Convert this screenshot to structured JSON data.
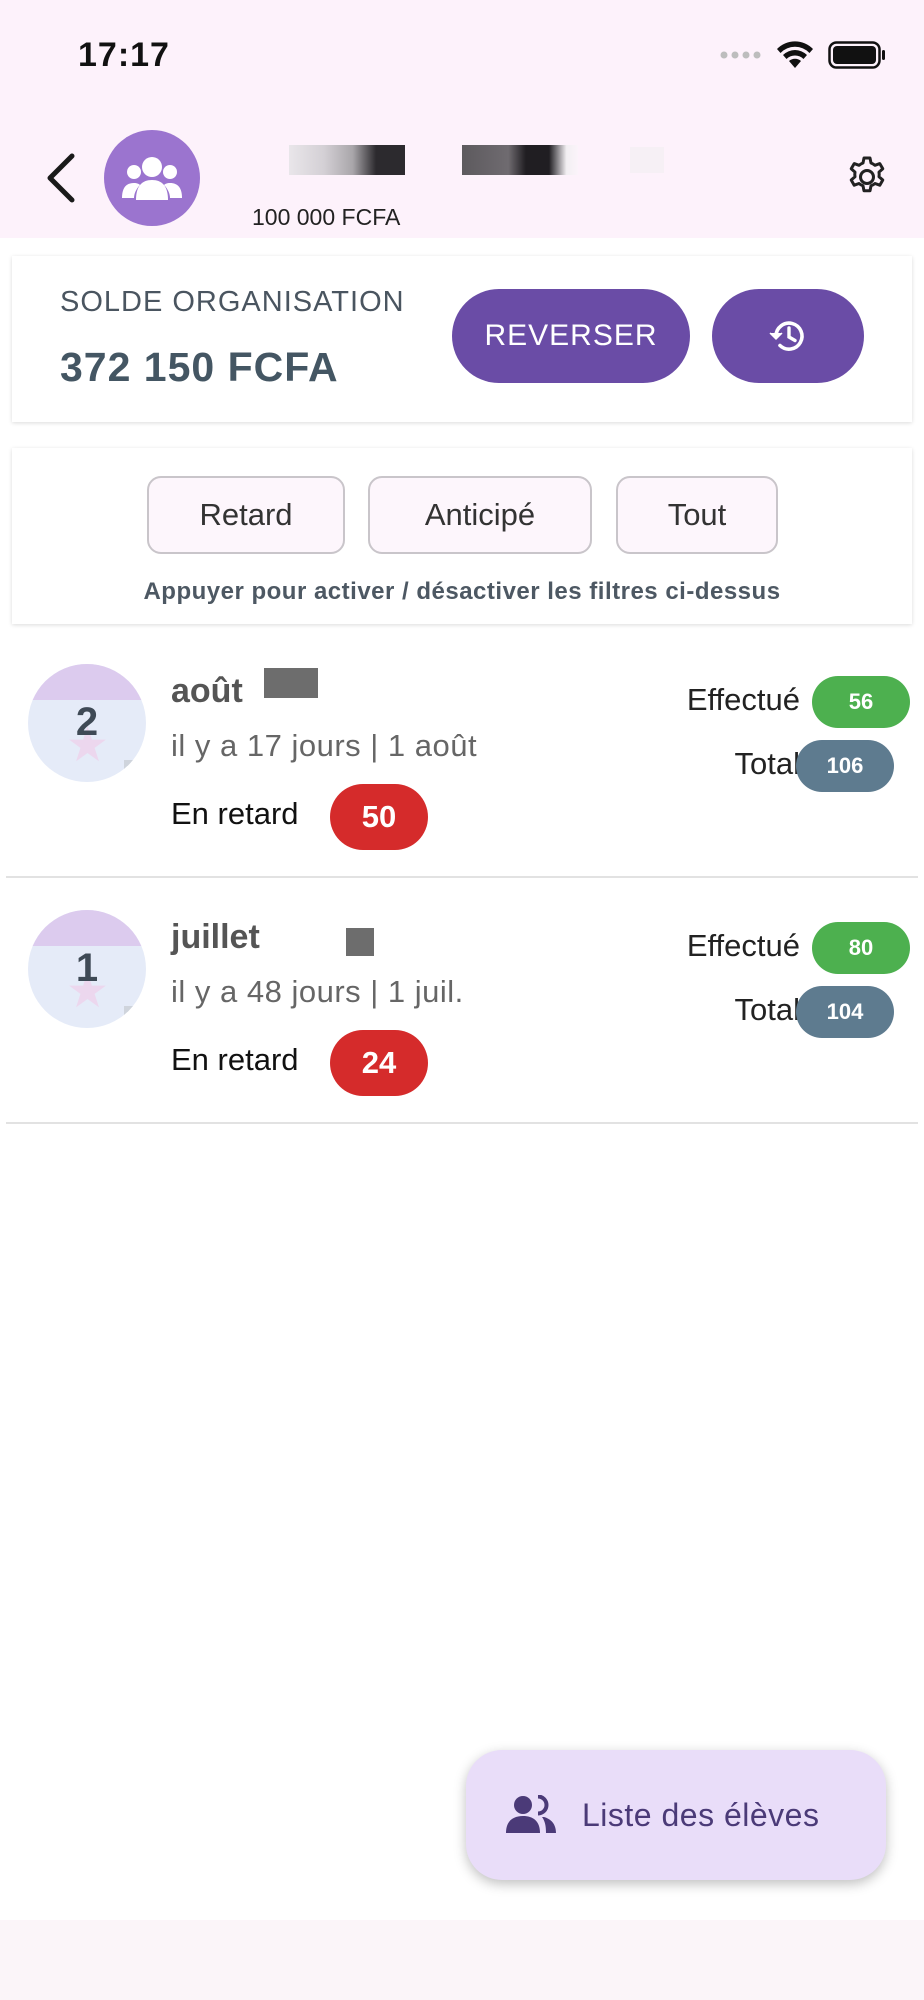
{
  "status_bar": {
    "time": "17:17"
  },
  "header": {
    "subtitle_amount": "100 000 FCFA",
    "background_color": "#fdf2fb",
    "avatar_color": "#9b74cf"
  },
  "balance": {
    "label": "SOLDE ORGANISATION",
    "value": "372 150 FCFA",
    "reverse_label": "REVERSER",
    "button_color": "#6a4ca6"
  },
  "filters": {
    "chips": [
      "Retard",
      "Anticipé",
      "Tout"
    ],
    "hint": "Appuyer pour activer / désactiver les filtres ci-dessus"
  },
  "months": [
    {
      "number": "2",
      "name": "août",
      "ago": "il y a 17 jours | 1 août",
      "late_label": "En retard",
      "late_count": "50",
      "done_label": "Effectué",
      "done_count": "56",
      "total_label": "Total",
      "total_count": "106"
    },
    {
      "number": "1",
      "name": "juillet",
      "ago": "il y a 48 jours | 1 juil.",
      "late_label": "En retard",
      "late_count": "24",
      "done_label": "Effectué",
      "done_count": "80",
      "total_label": "Total",
      "total_count": "104"
    }
  ],
  "colors": {
    "late": "#d52b2b",
    "done": "#4db04f",
    "total": "#5e7b8f"
  },
  "fab": {
    "label": "Liste des élèves"
  }
}
